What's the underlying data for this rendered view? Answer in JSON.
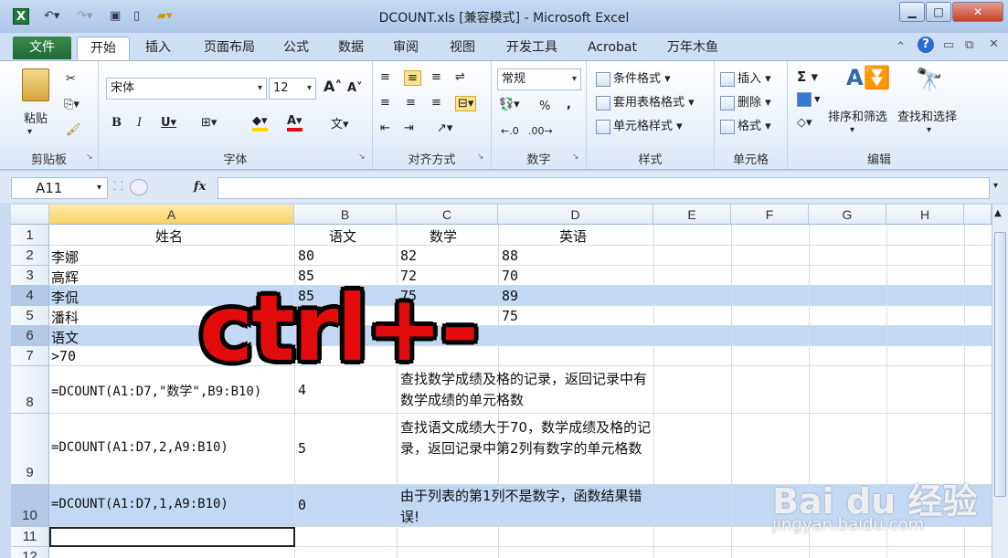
{
  "window": {
    "title": "DCOUNT.xls  [兼容模式] - Microsoft Excel",
    "app_icon": "X"
  },
  "ribbon_tabs": {
    "file": "文件",
    "items": [
      "开始",
      "插入",
      "页面布局",
      "公式",
      "数据",
      "审阅",
      "视图",
      "开发工具",
      "Acrobat",
      "万年木鱼"
    ]
  },
  "ribbon": {
    "paste": "粘贴",
    "font_name": "宋体",
    "font_size": "12",
    "number_format": "常规",
    "groups": {
      "clipboard": "剪贴板",
      "font": "字体",
      "align": "对齐方式",
      "number": "数字",
      "styles": "样式",
      "cells": "单元格",
      "edit": "编辑"
    },
    "styles": [
      "条件格式",
      "套用表格格式",
      "单元格样式"
    ],
    "cells": [
      "插入",
      "删除",
      "格式"
    ],
    "edit": [
      "排序和筛选",
      "查找和选择"
    ],
    "percent": "%",
    "comma": ","
  },
  "formula_bar": {
    "name_box": "A11",
    "fx": "fx",
    "value": ""
  },
  "columns": [
    "A",
    "B",
    "C",
    "D",
    "E",
    "F",
    "G",
    "H"
  ],
  "rows": [
    "1",
    "2",
    "3",
    "4",
    "5",
    "6",
    "7",
    "8",
    "9",
    "10",
    "11",
    "12"
  ],
  "cells": {
    "r1": {
      "a": "姓名",
      "b": "语文",
      "c": "数学",
      "d": "英语"
    },
    "r2": {
      "a": "李娜",
      "b": "80",
      "c": "82",
      "d": "88"
    },
    "r3": {
      "a": "高辉",
      "b": "85",
      "c": "72",
      "d": "70"
    },
    "r4": {
      "a": "李侃",
      "b": "85",
      "c": "75",
      "d": "89"
    },
    "r5": {
      "a": "潘科",
      "d": "75"
    },
    "r6": {
      "a": "语文"
    },
    "r7": {
      "a": ">70"
    },
    "r8": {
      "a": "=DCOUNT(A1:D7,\"数学\",B9:B10)",
      "b": "4",
      "c": "查找数学成绩及格的记录，返回记录中有数学成绩的单元格数"
    },
    "r9": {
      "a": "=DCOUNT(A1:D7,2,A9:B10)",
      "b": "5",
      "c": "查找语文成绩大于70，数学成绩及格的记录，返回记录中第2列有数字的单元格数"
    },
    "r10": {
      "a": "=DCOUNT(A1:D7,1,A9:B10)",
      "b": "0",
      "c": "由于列表的第1列不是数字，函数结果错误!"
    }
  },
  "overlay_text": "ctrl+-",
  "watermark": {
    "brand": "Bai du 经验",
    "url": "jingyan.baidu.com"
  },
  "colors": {
    "highlight_row": "#c3d8f2",
    "overlay_red": "#e30c0c",
    "file_tab": "#1e6a33"
  }
}
